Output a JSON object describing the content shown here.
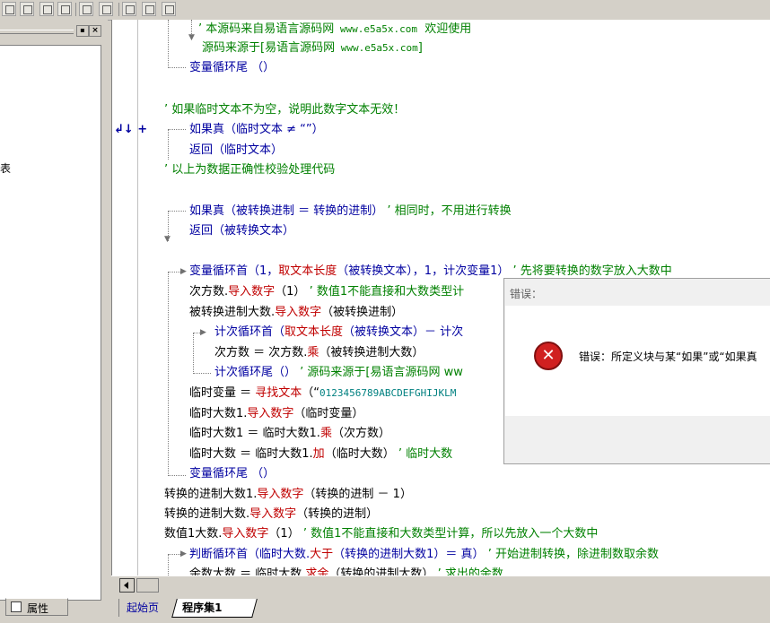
{
  "left_panel": {
    "fragment": "表",
    "property_tab": "属性"
  },
  "code": {
    "l1": "’ 本源码来自易语言源码网",
    "l1_url": " www.e5a5x.com",
    "l1_end": "  欢迎使用",
    "l2": "源码来源于[易语言源码网",
    "l2_url": " www.e5a5x.com",
    "l2_end": "]",
    "l3": "变量循环尾 （）",
    "l4": "’ 如果临时文本不为空，说明此数字文本无效！",
    "l5": "如果真（临时文本 ≠ “”）",
    "l6": "返回（临时文本）",
    "l7": "’ 以上为数据正确性校验处理代码",
    "l8a": "如果真（被转换进制 ＝ 转换的进制）",
    "l8b": " ’ 相同时，不用进行转换",
    "l9": "返回（被转换文本）",
    "l10a": "变量循环首（1，",
    "l10b": "取文本长度",
    "l10c": "（被转换文本），1，计次变量1）",
    "l10d": " ’ 先将要转换的数字放入大数中",
    "l11a": "次方数.",
    "l11b": "导入数字",
    "l11c": "（1）",
    "l11d": " ’ 数值1不能直接和大数类型计",
    "l12a": "被转换进制大数.",
    "l12b": "导入数字",
    "l12c": "（被转换进制）",
    "l13a": "计次循环首（",
    "l13b": "取文本长度",
    "l13c": "（被转换文本）－ 计次",
    "l14a": "次方数 ＝ 次方数.",
    "l14b": "乘",
    "l14c": "（被转换进制大数）",
    "l15a": "计次循环尾（）",
    "l15b": " ’ 源码来源于[易语言源码网 ww",
    "l16a": "临时变量 ＝ ",
    "l16b": "寻找文本",
    "l16c": "（“",
    "l16d": "0123456789ABCDEFGHIJKLM",
    "l17a": "临时大数1.",
    "l17b": "导入数字",
    "l17c": "（临时变量）",
    "l18a": "临时大数1 ＝ 临时大数1.",
    "l18b": "乘",
    "l18c": "（次方数）",
    "l19a": "临时大数 ＝ 临时大数1.",
    "l19b": "加",
    "l19c": "（临时大数）",
    "l19d": " ’ 临时大数",
    "l20": "变量循环尾 （）",
    "l21a": "转换的进制大数1.",
    "l21b": "导入数字",
    "l21c": "（转换的进制 － 1）",
    "l22a": "转换的进制大数.",
    "l22b": "导入数字",
    "l22c": "（转换的进制）",
    "l23a": "数值1大数.",
    "l23b": "导入数字",
    "l23c": "（1）",
    "l23d": " ’ 数值1不能直接和大数类型计算，所以先放入一个大数中",
    "l24a": "判断循环首（临时大数.",
    "l24b": "大于",
    "l24c": "（转换的进制大数1）＝ 真）",
    "l24d": " ’ 开始进制转换，除进制数取余数",
    "l25a": "余数大数 ＝ 临时大数.",
    "l25b": "求余",
    "l25c": "（转换的进制大数）",
    "l25d": " ’ 求出的余数"
  },
  "gutter_mark": "↲↓ +",
  "dialog": {
    "title": "错误：",
    "message": "错误：所定义块与某“如果”或“如果真"
  },
  "tabs": {
    "start": "起始页",
    "program": "程序集1"
  }
}
